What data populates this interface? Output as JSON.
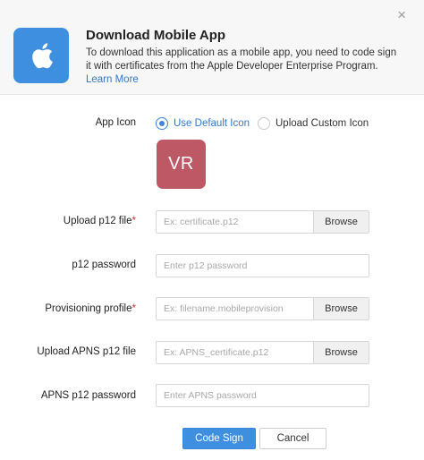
{
  "header": {
    "title": "Download Mobile App",
    "description": "To download this application as a mobile app, you need to code sign it with certificates from the Apple Developer Enterprise Program.",
    "learn_more": "Learn More",
    "close_glyph": "×",
    "apple_icon": "apple-icon",
    "tile_color": "#3e8fe0"
  },
  "app_icon": {
    "label": "App Icon",
    "option_default": "Use Default Icon",
    "option_custom": "Upload Custom Icon",
    "selected": "Use Default Icon",
    "preview_text": "VR",
    "preview_color": "#bd5865"
  },
  "fields": {
    "p12_file": {
      "label": "Upload p12 file",
      "required_mark": "*",
      "placeholder": "Ex: certificate.p12",
      "browse": "Browse"
    },
    "p12_password": {
      "label": "p12 password",
      "placeholder": "Enter p12 password"
    },
    "provisioning": {
      "label": "Provisioning profile",
      "required_mark": "*",
      "placeholder": "Ex: filename.mobileprovision",
      "browse": "Browse"
    },
    "apns_file": {
      "label": "Upload APNS p12 file",
      "placeholder": "Ex: APNS_certificate.p12",
      "browse": "Browse"
    },
    "apns_password": {
      "label": "APNS p12 password",
      "placeholder": "Enter APNS password"
    }
  },
  "actions": {
    "submit": "Code Sign",
    "cancel": "Cancel"
  },
  "colors": {
    "accent": "#3e8fe0",
    "link": "#2f7ac8",
    "required": "#d9302f"
  }
}
